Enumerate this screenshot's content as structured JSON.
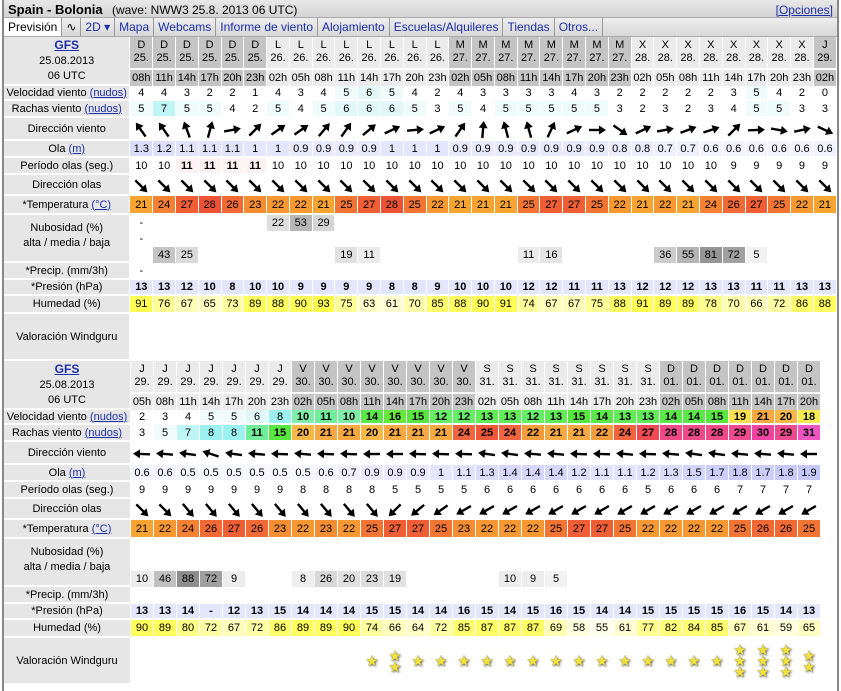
{
  "title": {
    "location": "Spain - Bolonia",
    "wave": "(wave: NWW3 25.8. 2013 06 UTC)",
    "options": "[Opciones]"
  },
  "tabs": [
    {
      "label": "Previsión",
      "active": true
    },
    {
      "label": "∿",
      "icon": "wave-chart-icon"
    },
    {
      "label": "2D ▾"
    },
    {
      "label": "Mapa"
    },
    {
      "label": "Webcams"
    },
    {
      "label": "Informe de viento"
    },
    {
      "label": "Alojamiento"
    },
    {
      "label": "Escuelas/Alquileres"
    },
    {
      "label": "Tiendas"
    },
    {
      "label": "Otros..."
    }
  ],
  "labels": {
    "model": "GFS",
    "date": "25.08.2013",
    "run": "06 UTC",
    "speed": "Velocidad viento",
    "gust": "Rachas viento",
    "knots": "(nudos)",
    "winddir": "Dirección viento",
    "wave": "Ola",
    "wave_unit": "(m)",
    "period": "Período olas (seg.)",
    "wavedir": "Dirección olas",
    "temp": "*Temperatura",
    "temp_unit": "(°C)",
    "cloud": "Nubosidad (%)",
    "cloud_sub": "alta / media / baja",
    "precip": "*Precip. (mm/3h)",
    "pressure": "*Presión (hPa)",
    "humidity": "Humedad (%)",
    "rating": "Valoración Windguru"
  },
  "tables": [
    {
      "days": [
        "D",
        "D",
        "D",
        "D",
        "D",
        "D",
        "L",
        "L",
        "L",
        "L",
        "L",
        "L",
        "L",
        "L",
        "M",
        "M",
        "M",
        "M",
        "M",
        "M",
        "M",
        "M",
        "X",
        "X",
        "X",
        "X",
        "X",
        "X",
        "X",
        "X",
        "J"
      ],
      "dates": [
        "25.",
        "25.",
        "25.",
        "25.",
        "25.",
        "25.",
        "26.",
        "26.",
        "26.",
        "26.",
        "26.",
        "26.",
        "26.",
        "26.",
        "27.",
        "27.",
        "27.",
        "27.",
        "27.",
        "27.",
        "27.",
        "27.",
        "28.",
        "28.",
        "28.",
        "28.",
        "28.",
        "28.",
        "28.",
        "28.",
        "29."
      ],
      "hours": [
        "08h",
        "11h",
        "14h",
        "17h",
        "20h",
        "23h",
        "02h",
        "05h",
        "08h",
        "11h",
        "14h",
        "17h",
        "20h",
        "23h",
        "02h",
        "05h",
        "08h",
        "11h",
        "14h",
        "17h",
        "20h",
        "23h",
        "02h",
        "05h",
        "08h",
        "11h",
        "14h",
        "17h",
        "20h",
        "23h",
        "02h"
      ],
      "speed": [
        4,
        4,
        3,
        2,
        2,
        1,
        4,
        3,
        4,
        5,
        6,
        5,
        4,
        2,
        4,
        3,
        3,
        3,
        3,
        4,
        3,
        2,
        2,
        2,
        2,
        2,
        3,
        5,
        4,
        2,
        0
      ],
      "gust": [
        5,
        7,
        5,
        5,
        4,
        2,
        5,
        4,
        5,
        6,
        6,
        6,
        5,
        3,
        5,
        4,
        5,
        5,
        5,
        5,
        5,
        3,
        2,
        3,
        2,
        3,
        4,
        5,
        5,
        3,
        3
      ],
      "winddir_deg": [
        325,
        325,
        340,
        15,
        80,
        45,
        55,
        55,
        40,
        35,
        50,
        65,
        85,
        65,
        35,
        5,
        345,
        345,
        25,
        65,
        90,
        125,
        65,
        80,
        70,
        72,
        45,
        88,
        100,
        78,
        115
      ],
      "wave": [
        "1.3",
        "1.2",
        "1.1",
        "1.1",
        "1.1",
        "1",
        "1",
        "0.9",
        "0.9",
        "0.9",
        "0.9",
        "1",
        "1",
        "1",
        "0.9",
        "0.9",
        "0.9",
        "0.9",
        "0.9",
        "0.9",
        "0.9",
        "0.8",
        "0.8",
        "0.7",
        "0.7",
        "0.6",
        "0.6",
        "0.6",
        "0.6",
        "0.6",
        "0.6"
      ],
      "period": [
        10,
        10,
        11,
        11,
        11,
        11,
        10,
        10,
        10,
        10,
        10,
        10,
        10,
        10,
        10,
        10,
        10,
        10,
        10,
        10,
        10,
        10,
        10,
        10,
        10,
        10,
        9,
        9,
        9,
        9,
        9
      ],
      "wavedir_deg": [
        135,
        135,
        135,
        135,
        135,
        135,
        135,
        135,
        135,
        135,
        135,
        135,
        135,
        135,
        135,
        135,
        135,
        135,
        135,
        135,
        135,
        135,
        135,
        135,
        135,
        135,
        135,
        135,
        135,
        135,
        135
      ],
      "temp": [
        21,
        24,
        27,
        28,
        26,
        23,
        22,
        22,
        21,
        25,
        27,
        28,
        25,
        22,
        21,
        21,
        21,
        25,
        27,
        27,
        25,
        22,
        21,
        22,
        21,
        24,
        26,
        27,
        25,
        22,
        21
      ],
      "cloud_high": [
        "-",
        "",
        "",
        "",
        "",
        "",
        "22",
        "53",
        "29",
        "",
        "",
        "",
        "",
        "",
        "",
        "",
        "",
        "",
        "",
        "",
        "",
        "",
        "",
        "",
        "",
        "",
        "",
        "",
        "",
        "",
        ""
      ],
      "cloud_mid": [
        "-",
        "",
        "",
        "",
        "",
        "",
        "",
        "",
        "",
        "",
        "",
        "",
        "",
        "",
        "",
        "",
        "",
        "",
        "",
        "",
        "",
        "",
        "",
        "",
        "",
        "",
        "",
        "",
        "",
        "",
        ""
      ],
      "cloud_low": [
        "",
        "43",
        "25",
        "",
        "",
        "",
        "",
        "",
        "",
        "19",
        "11",
        "",
        "",
        "",
        "",
        "",
        "",
        "11",
        "16",
        "",
        "",
        "",
        "",
        "36",
        "55",
        "81",
        "72",
        "5",
        "",
        "",
        ""
      ],
      "precip": [
        "-",
        "",
        "",
        "",
        "",
        "",
        "",
        "",
        "",
        "",
        "",
        "",
        "",
        "",
        "",
        "",
        "",
        "",
        "",
        "",
        "",
        "",
        "",
        "",
        "",
        "",
        "",
        "",
        "",
        "",
        ""
      ],
      "pressure": [
        "13",
        "13",
        "12",
        "10",
        "8",
        "10",
        "10",
        "9",
        "9",
        "9",
        "9",
        "8",
        "8",
        "9",
        "10",
        "10",
        "10",
        "12",
        "12",
        "11",
        "11",
        "13",
        "12",
        "12",
        "12",
        "13",
        "13",
        "11",
        "11",
        "13",
        "13"
      ],
      "humidity": [
        91,
        76,
        67,
        65,
        73,
        89,
        88,
        90,
        93,
        75,
        63,
        61,
        70,
        85,
        88,
        90,
        91,
        74,
        67,
        67,
        75,
        88,
        91,
        89,
        89,
        78,
        70,
        66,
        72,
        86,
        88
      ],
      "stars": [
        0,
        0,
        0,
        0,
        0,
        0,
        0,
        0,
        0,
        0,
        0,
        0,
        0,
        0,
        0,
        0,
        0,
        0,
        0,
        0,
        0,
        0,
        0,
        0,
        0,
        0,
        0,
        0,
        0,
        0,
        0
      ]
    },
    {
      "days": [
        "J",
        "J",
        "J",
        "J",
        "J",
        "J",
        "J",
        "V",
        "V",
        "V",
        "V",
        "V",
        "V",
        "V",
        "V",
        "S",
        "S",
        "S",
        "S",
        "S",
        "S",
        "S",
        "S",
        "D",
        "D",
        "D",
        "D",
        "D",
        "D",
        "D"
      ],
      "dates": [
        "29.",
        "29.",
        "29.",
        "29.",
        "29.",
        "29.",
        "29.",
        "30.",
        "30.",
        "30.",
        "30.",
        "30.",
        "30.",
        "30.",
        "30.",
        "31.",
        "31.",
        "31.",
        "31.",
        "31.",
        "31.",
        "31.",
        "31.",
        "01.",
        "01.",
        "01.",
        "01.",
        "01.",
        "01.",
        "01."
      ],
      "hours": [
        "05h",
        "08h",
        "11h",
        "14h",
        "17h",
        "20h",
        "23h",
        "02h",
        "05h",
        "08h",
        "11h",
        "14h",
        "17h",
        "20h",
        "23h",
        "02h",
        "05h",
        "08h",
        "11h",
        "14h",
        "17h",
        "20h",
        "23h",
        "02h",
        "05h",
        "08h",
        "11h",
        "14h",
        "17h",
        "20h"
      ],
      "speed": [
        2,
        3,
        4,
        5,
        5,
        6,
        8,
        10,
        11,
        10,
        14,
        16,
        15,
        12,
        12,
        13,
        13,
        12,
        13,
        15,
        14,
        13,
        13,
        14,
        14,
        15,
        19,
        21,
        20,
        18
      ],
      "gust": [
        3,
        5,
        7,
        8,
        8,
        11,
        15,
        20,
        21,
        21,
        20,
        21,
        21,
        21,
        24,
        25,
        24,
        22,
        21,
        21,
        22,
        24,
        27,
        28,
        28,
        28,
        29,
        30,
        29,
        31
      ],
      "winddir_deg": [
        272,
        275,
        278,
        288,
        278,
        275,
        272,
        275,
        272,
        272,
        270,
        270,
        272,
        272,
        272,
        278,
        278,
        275,
        275,
        272,
        272,
        275,
        272,
        275,
        278,
        278,
        275,
        275,
        275,
        270
      ],
      "wave": [
        "0.6",
        "0.6",
        "0.5",
        "0.5",
        "0.5",
        "0.5",
        "0.5",
        "0.5",
        "0.6",
        "0.7",
        "0.9",
        "0.9",
        "0.9",
        "1",
        "1.1",
        "1.3",
        "1.4",
        "1.4",
        "1.4",
        "1.2",
        "1.1",
        "1.1",
        "1.2",
        "1.3",
        "1.5",
        "1.7",
        "1.8",
        "1.7",
        "1.8",
        "1.9"
      ],
      "period": [
        9,
        9,
        9,
        9,
        9,
        9,
        9,
        8,
        8,
        8,
        8,
        5,
        5,
        5,
        5,
        6,
        6,
        6,
        6,
        6,
        6,
        6,
        5,
        6,
        6,
        6,
        7,
        7,
        7,
        7
      ],
      "wavedir_deg": [
        135,
        135,
        140,
        140,
        140,
        140,
        140,
        140,
        140,
        140,
        140,
        225,
        230,
        235,
        240,
        240,
        240,
        240,
        240,
        240,
        240,
        240,
        240,
        240,
        240,
        240,
        240,
        240,
        240,
        240
      ],
      "temp": [
        21,
        22,
        24,
        26,
        27,
        26,
        23,
        22,
        23,
        22,
        25,
        27,
        27,
        25,
        23,
        22,
        22,
        22,
        25,
        27,
        27,
        25,
        22,
        22,
        22,
        22,
        25,
        26,
        26,
        25
      ],
      "cloud_high": [
        "",
        "",
        "",
        "",
        "",
        "",
        "",
        "",
        "",
        "",
        "",
        "",
        "",
        "",
        "",
        "",
        "",
        "",
        "",
        "",
        "",
        "",
        "",
        "",
        "",
        "",
        "",
        "",
        "",
        ""
      ],
      "cloud_mid": [
        "",
        "",
        "",
        "",
        "",
        "",
        "",
        "",
        "",
        "",
        "",
        "",
        "",
        "",
        "",
        "",
        "",
        "",
        "",
        "",
        "",
        "",
        "",
        "",
        "",
        "",
        "",
        "",
        "",
        ""
      ],
      "cloud_low": [
        "10",
        "46",
        "88",
        "72",
        "9",
        "",
        "",
        "8",
        "26",
        "20",
        "23",
        "19",
        "",
        "",
        "",
        "",
        "10",
        "9",
        "5",
        "",
        "",
        "",
        "",
        "",
        "",
        "",
        "",
        "",
        "",
        ""
      ],
      "precip": [
        "",
        "",
        "",
        "",
        "",
        "",
        "",
        "",
        "",
        "",
        "",
        "",
        "",
        "",
        "",
        "",
        "",
        "",
        "",
        "",
        "",
        "",
        "",
        "",
        "",
        "",
        "",
        "",
        "",
        ""
      ],
      "pressure": [
        "13",
        "13",
        "14",
        "-",
        "12",
        "13",
        "15",
        "14",
        "14",
        "14",
        "15",
        "15",
        "14",
        "14",
        "16",
        "15",
        "14",
        "15",
        "16",
        "15",
        "14",
        "14",
        "15",
        "15",
        "15",
        "15",
        "16",
        "15",
        "14",
        "13"
      ],
      "humidity": [
        90,
        89,
        80,
        72,
        67,
        72,
        86,
        89,
        89,
        90,
        74,
        66,
        64,
        72,
        85,
        87,
        87,
        87,
        69,
        58,
        55,
        61,
        77,
        82,
        84,
        85,
        67,
        61,
        59,
        65
      ],
      "stars": [
        0,
        0,
        0,
        0,
        0,
        0,
        0,
        0,
        0,
        0,
        1,
        2,
        1,
        1,
        1,
        1,
        1,
        1,
        1,
        1,
        1,
        1,
        1,
        1,
        1,
        1,
        3,
        3,
        3,
        2
      ]
    }
  ]
}
